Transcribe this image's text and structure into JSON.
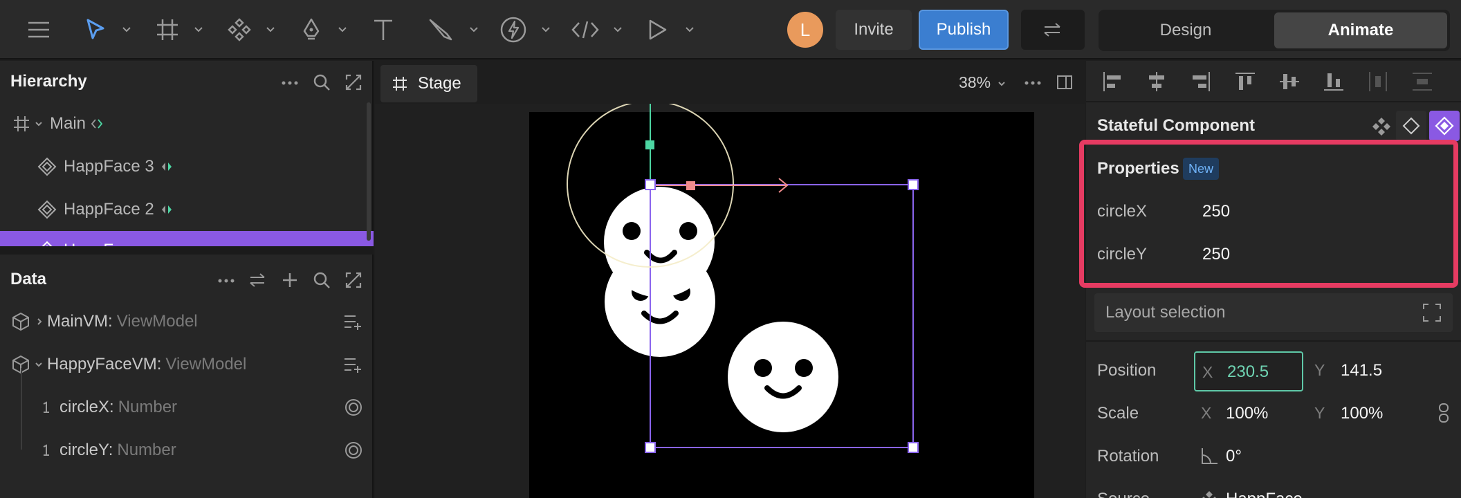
{
  "toolbar": {
    "avatar_initial": "L",
    "invite_label": "Invite",
    "publish_label": "Publish",
    "mode_design": "Design",
    "mode_animate": "Animate"
  },
  "hierarchy": {
    "title": "Hierarchy",
    "items": [
      {
        "label": "Main"
      },
      {
        "label": "HappFace 3"
      },
      {
        "label": "HappFace 2"
      },
      {
        "label": "HappFace"
      }
    ]
  },
  "data_panel": {
    "title": "Data",
    "viewmodels": [
      {
        "name": "MainVM:",
        "type": "ViewModel"
      },
      {
        "name": "HappyFaceVM:",
        "type": "ViewModel"
      }
    ],
    "fields": [
      {
        "name": "circleX:",
        "type": "Number"
      },
      {
        "name": "circleY:",
        "type": "Number"
      }
    ]
  },
  "stage": {
    "tab_label": "Stage",
    "zoom": "38%"
  },
  "inspector": {
    "component_title": "Stateful Component",
    "properties_title": "Properties",
    "new_badge": "New",
    "properties": [
      {
        "label": "circleX",
        "value": "250"
      },
      {
        "label": "circleY",
        "value": "250"
      }
    ],
    "layout_selection": "Layout selection",
    "position_label": "Position",
    "position_x": "230.5",
    "position_y": "141.5",
    "scale_label": "Scale",
    "scale_x": "100%",
    "scale_y": "100%",
    "rotation_label": "Rotation",
    "rotation_value": "0°",
    "source_label": "Source",
    "source_value": "HappFace",
    "axis_x": "X",
    "axis_y": "Y"
  },
  "colors": {
    "accent_purple": "#8a59e3",
    "publish_blue": "#3b7ed0",
    "highlight_red": "#e63b62",
    "field_focus_green": "#5fc9a8"
  }
}
